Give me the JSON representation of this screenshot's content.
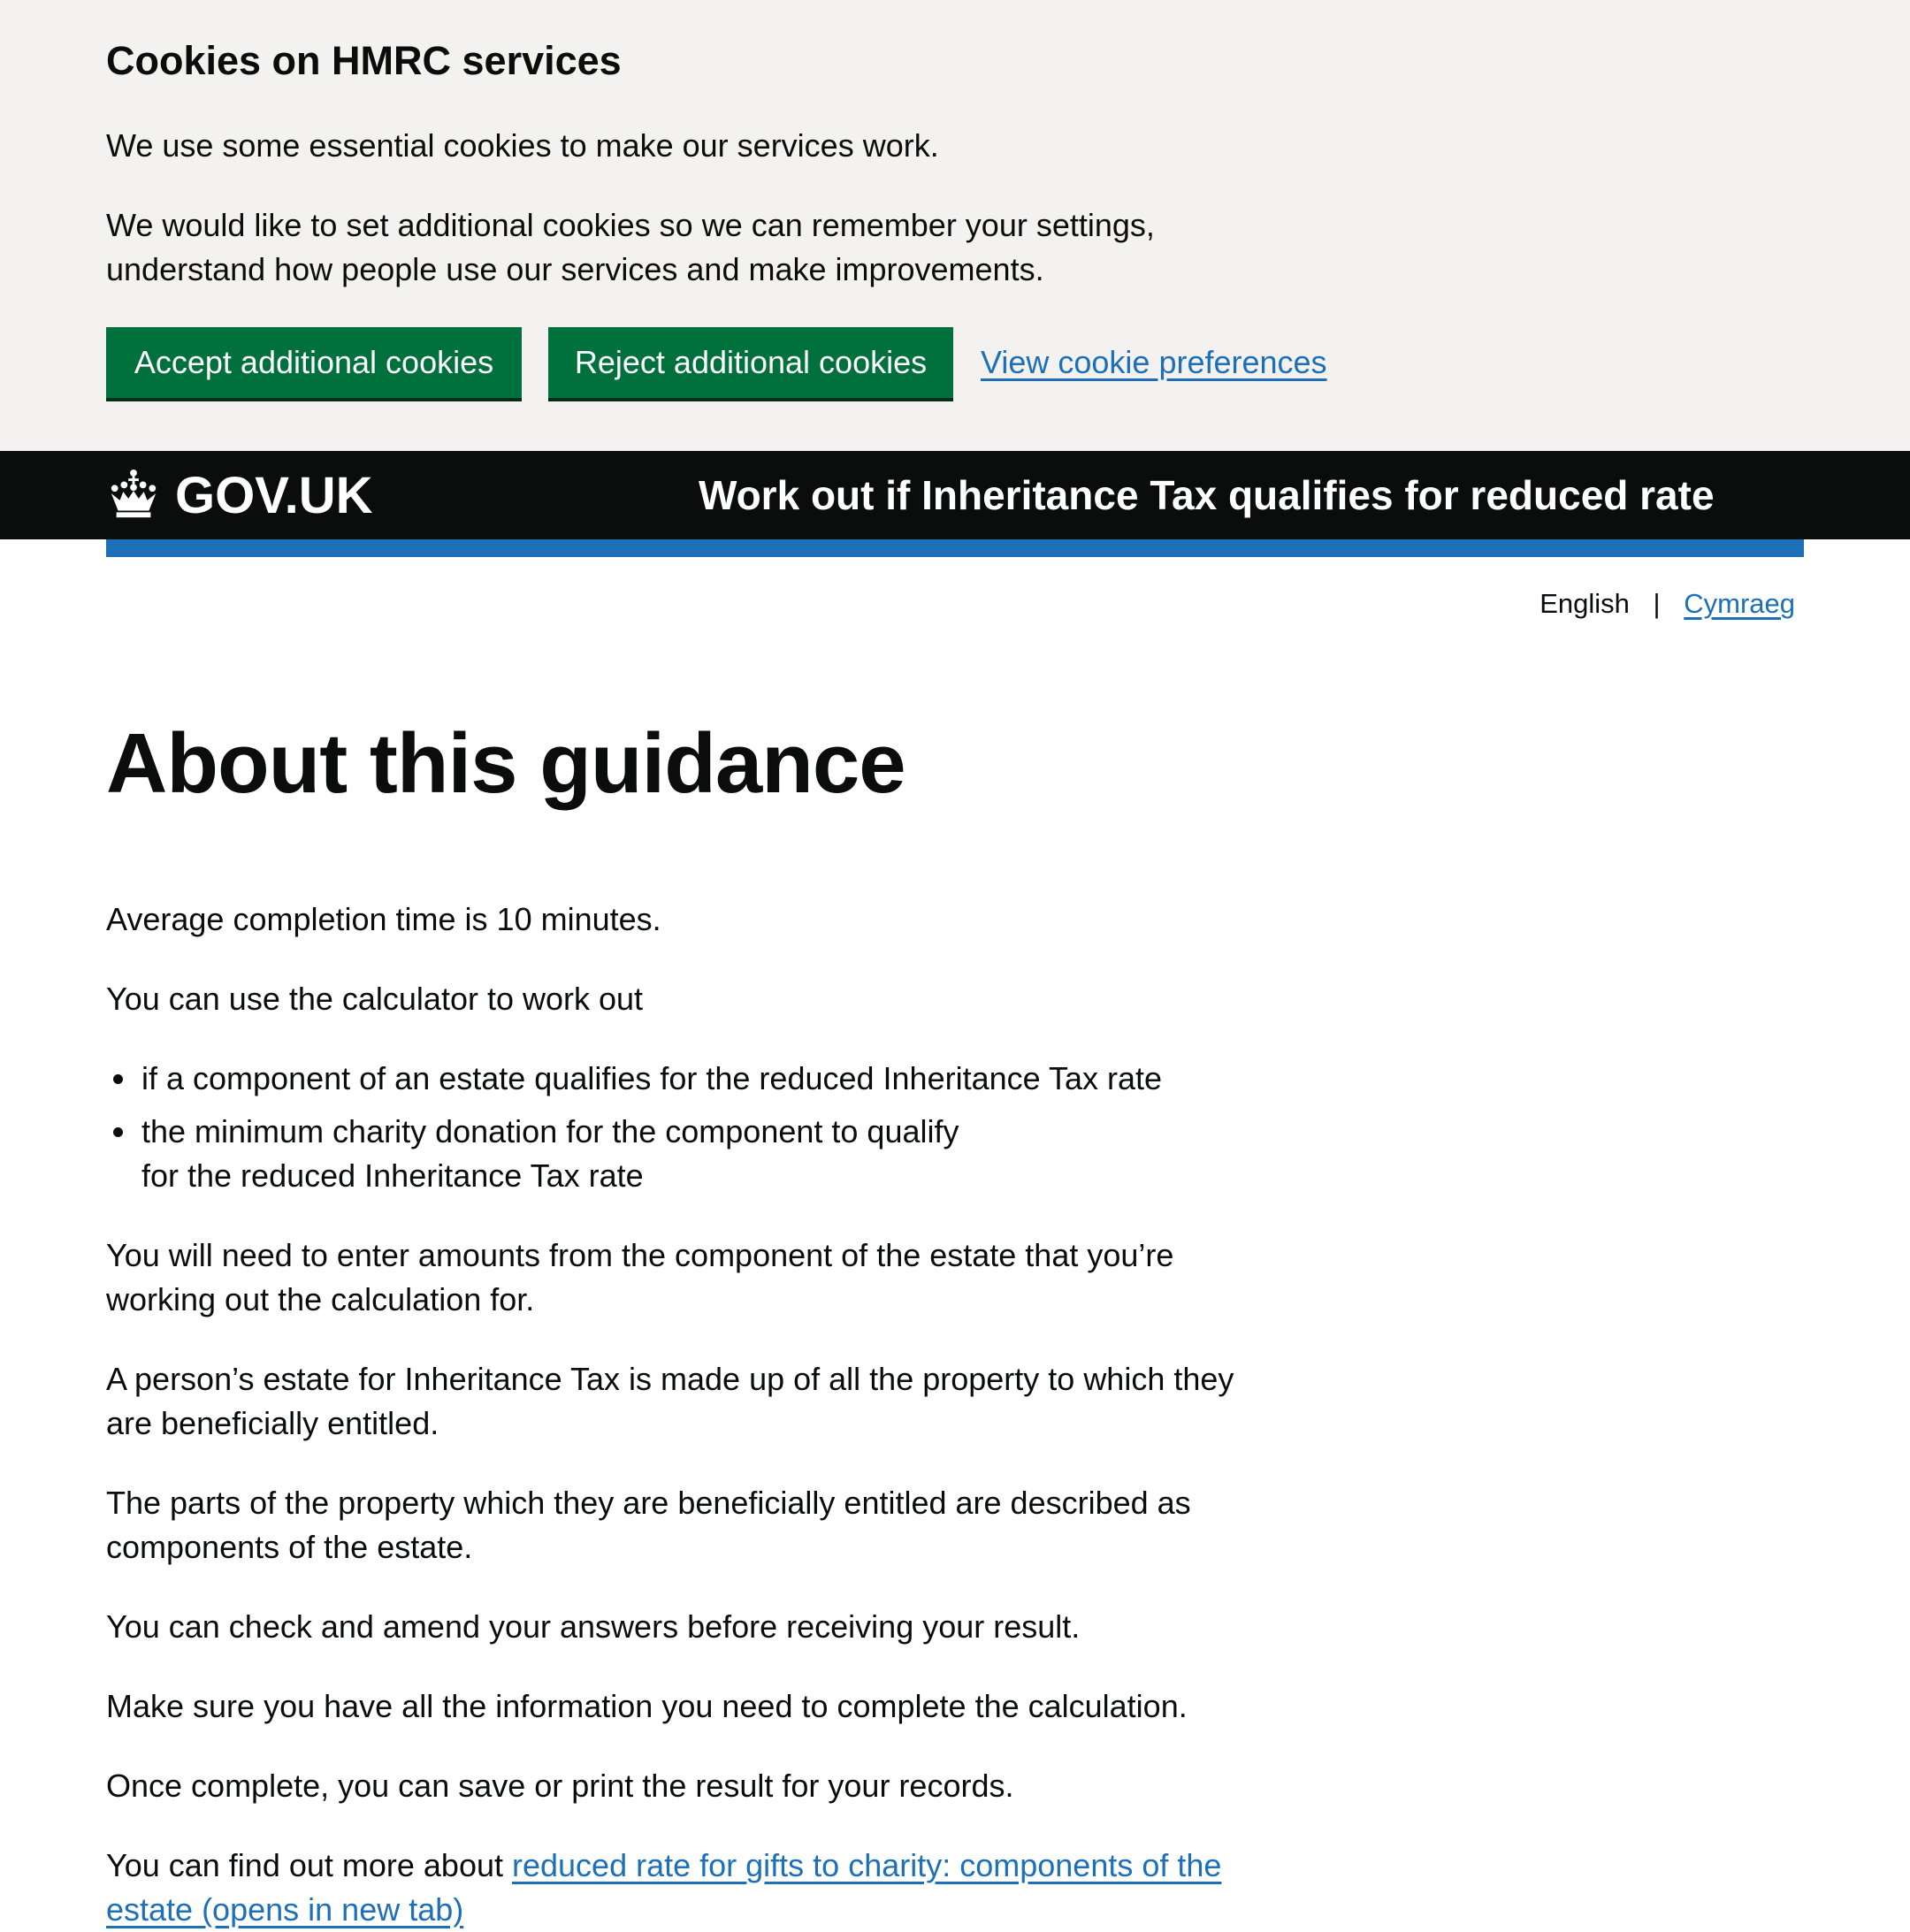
{
  "cookie_banner": {
    "title": "Cookies on HMRC services",
    "paragraph_1": "We use some essential cookies to make our services work.",
    "paragraph_2": "We would like to set additional cookies so we can remember your settings, understand how people use our services and make improvements.",
    "accept_label": "Accept additional cookies",
    "reject_label": "Reject additional cookies",
    "preferences_label": "View cookie preferences"
  },
  "header": {
    "logo_text": "GOV.UK",
    "logo_icon": "crown-icon",
    "service_name": "Work out if Inheritance Tax qualifies for reduced rate",
    "accent_color": "#1d70b8"
  },
  "language": {
    "current": "English",
    "separator": "|",
    "alternate": "Cymraeg"
  },
  "main": {
    "title": "About this guidance",
    "p_completion_time": "Average completion time is 10 minutes.",
    "p_use_calculator": "You can use the calculator to work out",
    "bullets": [
      "if a component of an estate qualifies for the reduced Inheritance Tax rate",
      "the minimum charity donation for the component to qualify for the reduced Inheritance Tax rate"
    ],
    "p_enter_amounts": "You will need to enter amounts from the component of the estate that you’re working out the calculation for.",
    "p_estate_definition": "A person’s estate for Inheritance Tax is made up of all the property to which they are beneficially entitled.",
    "p_components": "The parts of the property which they are beneficially entitled are described as components of the estate.",
    "p_check_amend": "You can check and amend your answers before receiving your result.",
    "p_make_sure": "Make sure you have all the information you need to complete the calculation.",
    "p_save_print": "Once complete, you can save or print the result for your records.",
    "p_find_more_prefix": "You can find out more about ",
    "p_find_more_link": "reduced rate for gifts to charity: components of the estate (opens in new tab)"
  },
  "colors": {
    "banner_bg": "#f3f2f1",
    "button_green": "#00703c",
    "link_blue": "#1d70b8",
    "header_black": "#0b0c0c"
  }
}
